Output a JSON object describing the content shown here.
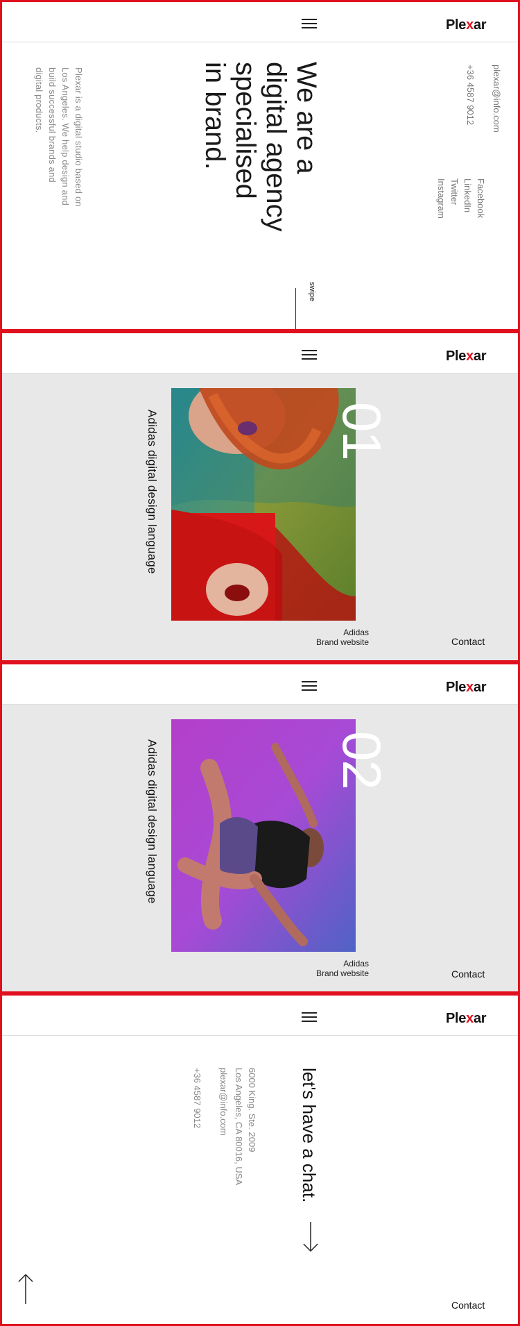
{
  "brand": {
    "logo_prefix": "Ple",
    "logo_x": "x",
    "logo_suffix": "ar"
  },
  "hero": {
    "title": "We are a\ndigital agency\nspecialised\nin brand.",
    "description": "Plexar is a digital studio based on\nLos Angeles. We help design and\nbuild successful brands and\ndigital products.",
    "email": "plexar@info.com",
    "phone": "+36 4587 9012",
    "socials": "Facebook\nLinkedIn\nTwitter\nInstagram",
    "swipe": "swipe"
  },
  "works": [
    {
      "number": "01",
      "caption": "Adidas digital design language",
      "client": "Adidas",
      "type": "Brand website",
      "contact": "Contact"
    },
    {
      "number": "02",
      "caption": "Adidas digital design language",
      "client": "Adidas",
      "type": "Brand website",
      "contact": "Contact"
    }
  ],
  "chat": {
    "title": "let's have a chat.",
    "address": "6000 King. Ste. 2009\nLos Angeles, CA 80016, USA",
    "email": "plexar@info.com",
    "phone": "+36 4587 9012",
    "contact": "Contact"
  },
  "icons": {
    "menu": "hamburger-menu-icon",
    "down": "arrow-down-icon",
    "up": "arrow-up-icon"
  },
  "colors": {
    "accent": "#e0101e",
    "panel_gray": "#e8e8e8"
  }
}
